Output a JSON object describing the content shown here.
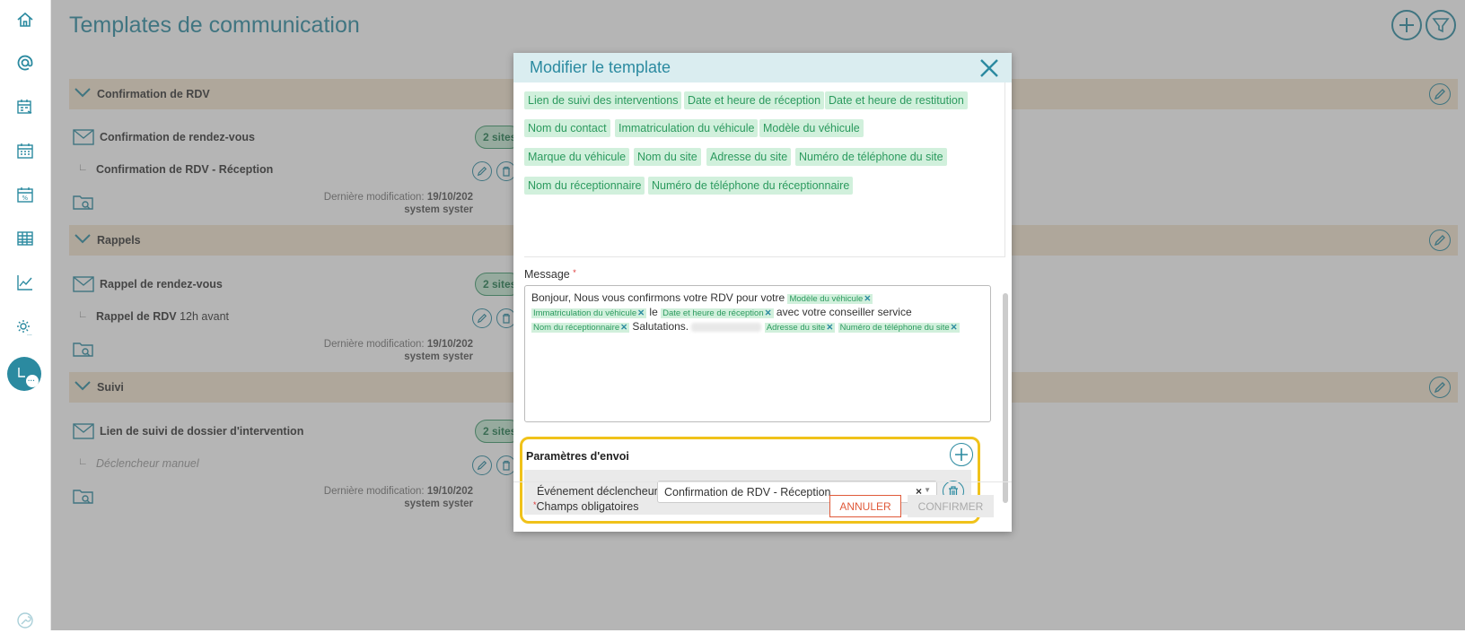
{
  "page": {
    "title": "Templates de communication"
  },
  "sidebar": {
    "items": [
      {
        "icon": "home-icon"
      },
      {
        "icon": "at-icon"
      },
      {
        "icon": "calendar-list-icon"
      },
      {
        "icon": "calendar-icon"
      },
      {
        "icon": "calendar-percent-icon"
      },
      {
        "icon": "table-icon"
      },
      {
        "icon": "chart-line-icon"
      },
      {
        "icon": "settings-icon"
      },
      {
        "icon": "chat-avatar-icon"
      },
      {
        "icon": "wrench-icon"
      }
    ]
  },
  "sections": [
    {
      "title": "Confirmation de RDV",
      "template": "Confirmation de rendez-vous",
      "badge": "2 sites",
      "sub_bold": "Confirmation de RDV - Réception",
      "sub_text": "",
      "mod_label": "Dernière modification: ",
      "mod_date": "19/10/202",
      "mod_user": "system syster"
    },
    {
      "title": "Rappels",
      "template": "Rappel de rendez-vous",
      "badge": "2 sites",
      "sub_bold": "Rappel de RDV",
      "sub_text": "12h avant",
      "mod_label": "Dernière modification: ",
      "mod_date": "19/10/202",
      "mod_user": "system syster"
    },
    {
      "title": "Suivi",
      "template": "Lien de suivi de dossier d'intervention",
      "badge": "2 sites",
      "sub_bold": "",
      "sub_text": "Déclencheur manuel",
      "mod_label": "Dernière modification: ",
      "mod_date": "19/10/202",
      "mod_user": "system syster"
    }
  ],
  "modal": {
    "title": "Modifier le template",
    "chips": [
      "Lien de suivi des interventions",
      "Date et heure de réception",
      "Date et heure de restitution",
      "Nom du contact",
      "Immatriculation du véhicule",
      "Modèle du véhicule",
      "Marque du véhicule",
      "Nom du site",
      "Adresse du site",
      "Numéro de téléphone du site",
      "Nom du réceptionnaire",
      "Numéro de téléphone du réceptionnaire"
    ],
    "message_label": "Message",
    "message": {
      "t1": "Bonjour, Nous vous confirmons votre RDV pour votre",
      "tag1": "Modèle du véhicule",
      "tag2": "Immatriculation du véhicule",
      "t2": "le",
      "tag3": "Date et heure de réception",
      "t3": "avec votre conseiller service",
      "tag4": "Nom du réceptionnaire",
      "t4": "Salutations.",
      "tag5": "Adresse du site",
      "tag6": "Numéro de téléphone du site"
    },
    "params_title": "Paramètres d'envoi",
    "event_label": "Événement déclencheur",
    "event_value": "Confirmation de RDV - Réception",
    "required_note": "Champs obligatoires",
    "cancel": "ANNULER",
    "confirm": "CONFIRMER"
  },
  "colors": {
    "accent": "#2b8aa0",
    "chip_bg": "#d1f0dc",
    "section_bg": "#f5e6cf",
    "highlight": "#f0c21a",
    "cancel": "#e05a3a"
  }
}
